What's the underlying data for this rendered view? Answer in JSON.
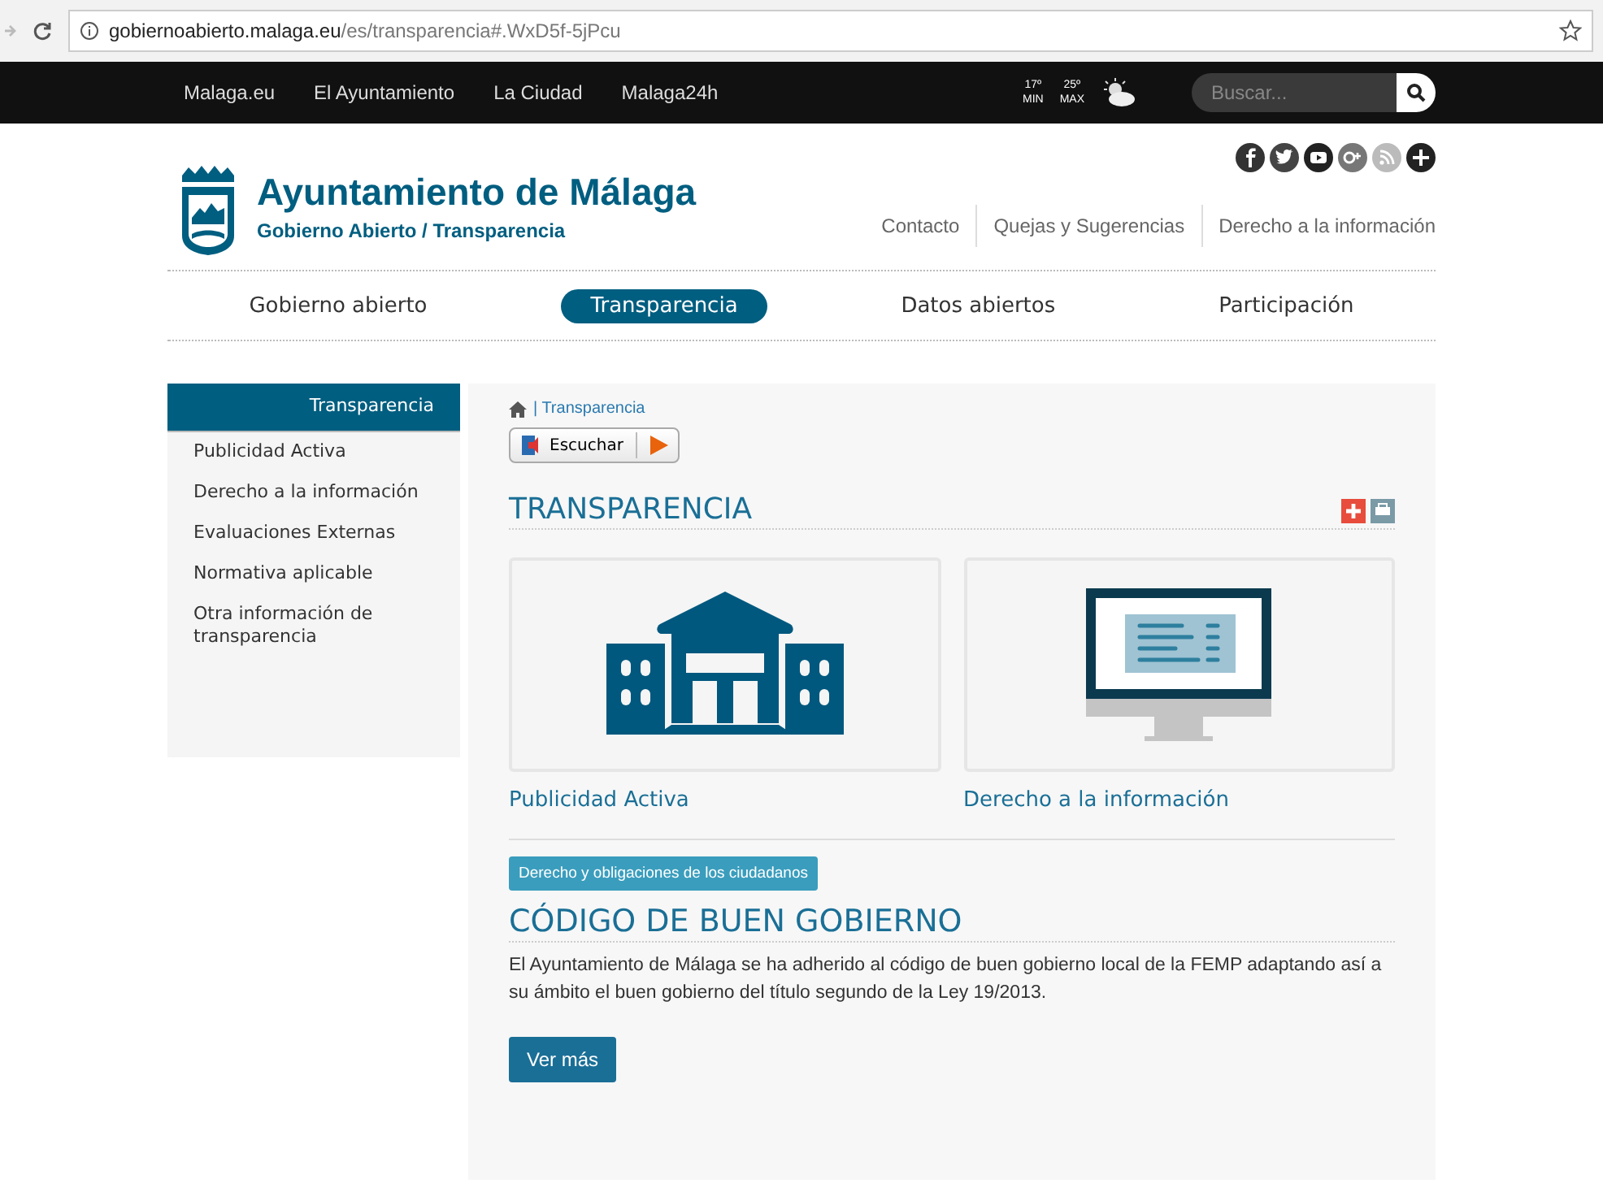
{
  "browser": {
    "url_host": "gobiernoabierto.malaga.eu",
    "url_path": "/es/transparencia#.WxD5f-5jPcu"
  },
  "topbar": {
    "links": [
      "Malaga.eu",
      "El Ayuntamiento",
      "La Ciudad",
      "Malaga24h"
    ],
    "weather": [
      {
        "temp": "17º",
        "label": "MIN"
      },
      {
        "temp": "25º",
        "label": "MAX"
      }
    ],
    "search": {
      "placeholder": "Buscar..."
    }
  },
  "header": {
    "title": "Ayuntamiento de Málaga",
    "subtitle": "Gobierno Abierto / Transparencia",
    "links": [
      "Contacto",
      "Quejas y Sugerencias",
      "Derecho a la información"
    ]
  },
  "main_nav": [
    {
      "label": "Gobierno abierto",
      "selected": false
    },
    {
      "label": "Transparencia",
      "selected": true
    },
    {
      "label": "Datos abiertos",
      "selected": false
    },
    {
      "label": "Participación",
      "selected": false
    }
  ],
  "sidebar": {
    "items": [
      {
        "label": "Transparencia",
        "selected": true
      },
      {
        "label": "Publicidad Activa",
        "selected": false
      },
      {
        "label": "Derecho a la información",
        "selected": false
      },
      {
        "label": "Evaluaciones Externas",
        "selected": false
      },
      {
        "label": "Normativa aplicable",
        "selected": false
      },
      {
        "label": "Otra información de transparencia",
        "selected": false
      }
    ]
  },
  "breadcrumb": "| Transparencia",
  "listen_button": "Escuchar",
  "section_title": "TRANSPARENCIA",
  "cards": [
    {
      "kind": "building",
      "label": "Publicidad Activa"
    },
    {
      "kind": "monitor",
      "label": "Derecho a la información"
    }
  ],
  "tag": "Derecho y obligaciones de los ciudadanos",
  "code_title": "CÓDIGO DE BUEN GOBIERNO",
  "code_text": "El Ayuntamiento de Málaga se ha adherido al código de buen gobierno local de la FEMP adaptando así a su ámbito el buen gobierno del título segundo de la Ley 19/2013.",
  "more_button": "Ver más"
}
